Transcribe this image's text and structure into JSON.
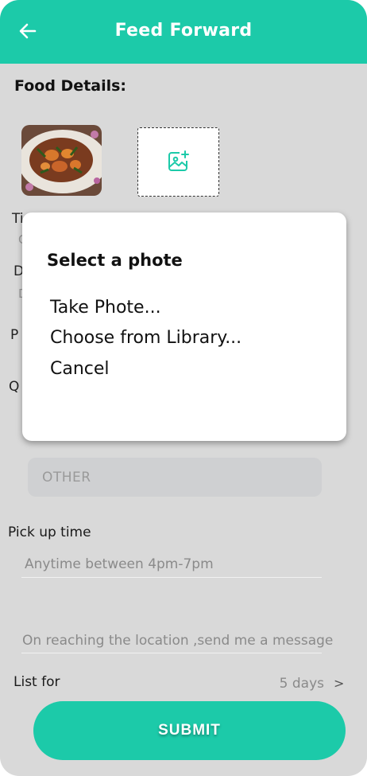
{
  "header": {
    "title": "Feed Forward",
    "back_icon": "arrow-left-icon",
    "color": "#1ccaa9"
  },
  "food_details": {
    "title": "Food Details:",
    "photo_icon": "image-add-icon"
  },
  "peek": {
    "title_initial": "Ti",
    "title_sub": "C",
    "desc_initial": "D",
    "desc_sub": "D",
    "price_initial": "P",
    "qty_initial": "Q"
  },
  "other_option": "OTHER",
  "pickup": {
    "label": "Pick up time",
    "value": "Anytime between 4pm-7pm"
  },
  "instructions": {
    "value": "On reaching the location ,send me a message"
  },
  "list_for": {
    "label": "List for",
    "value": "5 days",
    "chevron": ">"
  },
  "submit": {
    "label": "SUBMIT"
  },
  "modal": {
    "title": "Select a phote",
    "options": [
      "Take Phote...",
      "Choose from Library...",
      "Cancel"
    ]
  }
}
